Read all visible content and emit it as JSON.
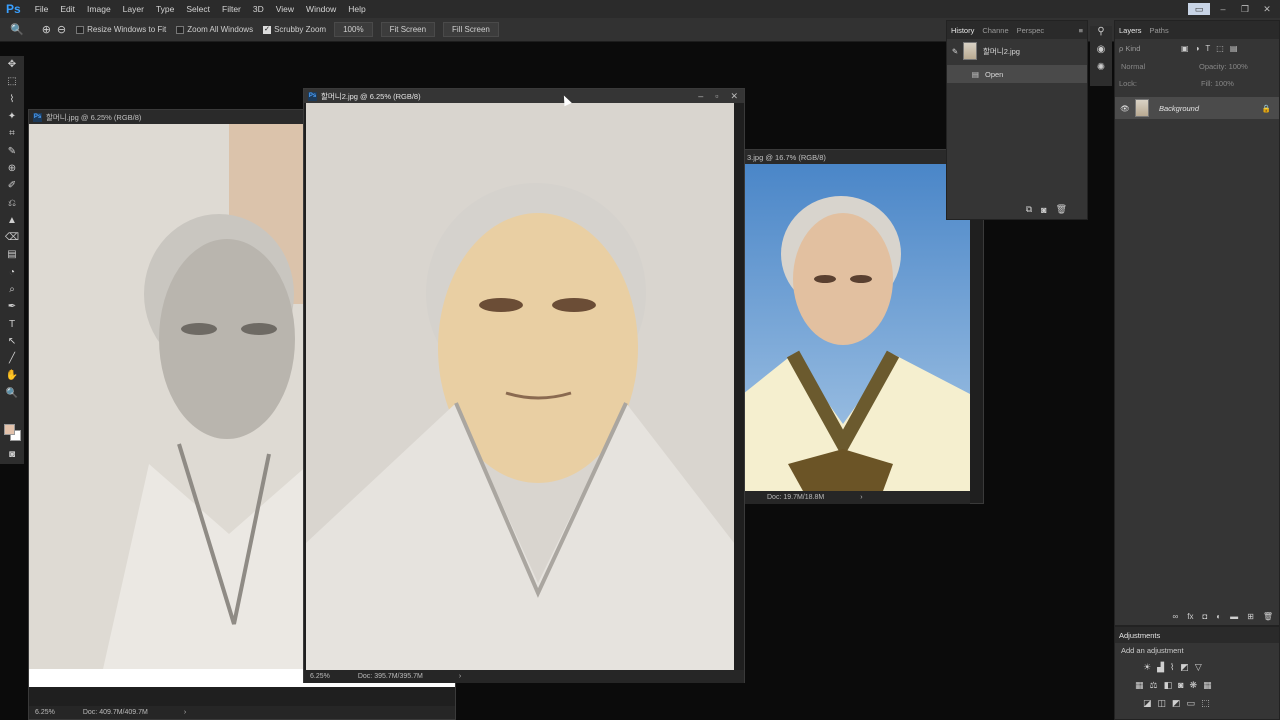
{
  "app": {
    "logo": "Ps"
  },
  "menu": [
    "File",
    "Edit",
    "Image",
    "Layer",
    "Type",
    "Select",
    "Filter",
    "3D",
    "View",
    "Window",
    "Help"
  ],
  "window_controls": [
    "▭",
    "–",
    "❐",
    "✕"
  ],
  "options": {
    "zoom_icon": "🔍",
    "resize_windows": "Resize Windows to Fit",
    "zoom_all_windows": "Zoom All Windows",
    "scrubby_zoom": "Scrubby Zoom",
    "zoom_100": "100%",
    "fit_screen": "Fit Screen",
    "fill_screen": "Fill Screen"
  },
  "tools": [
    "✥",
    "⬚",
    "⌇",
    "✦",
    "⌗",
    "✎",
    "⊕",
    "✐",
    "⎌",
    "▲",
    "⌫",
    "▤",
    "◔",
    "⌕",
    "✒",
    "T",
    "↖",
    "╱",
    "✋",
    "🔍"
  ],
  "doc_left": {
    "title": "할머니.jpg @ 6.25% (RGB/8)",
    "zoom": "6.25%",
    "doc": "Doc: 409.7M/409.7M",
    "arrow": "›"
  },
  "doc_center": {
    "title": "할머니2.jpg @ 6.25% (RGB/8)",
    "zoom": "6.25%",
    "doc": "Doc: 395.7M/395.7M",
    "arrow": "›"
  },
  "doc_right": {
    "title": "3.jpg @ 16.7% (RGB/8)",
    "doc": "Doc: 19.7M/18.8M",
    "arrow": "›"
  },
  "history": {
    "tabs": [
      "History",
      "Channe",
      "Perspec"
    ],
    "snapshot_label": "할머니2.jpg",
    "items": [
      "Open"
    ]
  },
  "layers": {
    "tabs": [
      "Layers",
      "Paths"
    ],
    "kind": "ρ Kind",
    "blend": "Normal",
    "opacity": "Opacity: 100%",
    "lock": "Lock:",
    "fill": "Fill: 100%",
    "items": [
      {
        "name": "Background"
      }
    ]
  },
  "adjustments": {
    "tab": "Adjustments",
    "subtitle": "Add an adjustment"
  }
}
